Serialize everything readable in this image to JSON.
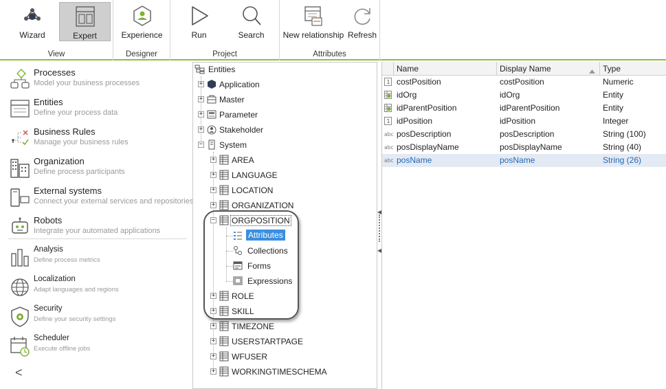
{
  "ribbon": {
    "groups": [
      {
        "label": "View"
      },
      {
        "label": "Designer"
      },
      {
        "label": "Project"
      },
      {
        "label": "Attributes"
      }
    ],
    "buttons": {
      "wizard": "Wizard",
      "expert": "Expert",
      "experience": "Experience",
      "run": "Run",
      "search": "Search",
      "new_relationship": "New relationship",
      "refresh": "Refresh"
    },
    "accent_color": "#8cbf3f"
  },
  "sidebar": {
    "items": [
      {
        "title": "Processes",
        "desc": "Model your business processes",
        "icon": "processes-icon"
      },
      {
        "title": "Entities",
        "desc": "Define your process data",
        "icon": "entities-icon"
      },
      {
        "title": "Business Rules",
        "desc": "Manage your business rules",
        "icon": "business-rules-icon"
      },
      {
        "title": "Organization",
        "desc": "Define process participants",
        "icon": "organization-icon"
      },
      {
        "title": "External systems",
        "desc": "Connect your external services and repositories",
        "icon": "external-systems-icon"
      },
      {
        "title": "Robots",
        "desc": "Integrate your automated applications",
        "icon": "robots-icon"
      },
      {
        "title": "Analysis",
        "desc": "Define process metrics",
        "icon": "analysis-icon"
      },
      {
        "title": "Localization",
        "desc": "Adapt languages and regions",
        "icon": "localization-icon"
      },
      {
        "title": "Security",
        "desc": "Define your security settings",
        "icon": "security-icon"
      },
      {
        "title": "Scheduler",
        "desc": "Execute offline jobs",
        "icon": "scheduler-icon"
      }
    ],
    "collapse_glyph": "<"
  },
  "tree": {
    "root": "Entities",
    "top": [
      "Application",
      "Master",
      "Parameter",
      "Stakeholder",
      "System"
    ],
    "system_children": [
      "AREA",
      "LANGUAGE",
      "LOCATION",
      "ORGANIZATION",
      "ORGPOSITION"
    ],
    "orgposition_children": [
      "Attributes",
      "Collections",
      "Forms",
      "Expressions"
    ],
    "after": [
      "ROLE",
      "SKILL",
      "TIMEZONE",
      "USERSTARTPAGE",
      "WFUSER",
      "WORKINGTIMESCHEMA"
    ]
  },
  "grid": {
    "columns": [
      "Name",
      "Display Name",
      "Type"
    ],
    "rows": [
      {
        "name": "costPosition",
        "display": "costPosition",
        "type": "Numeric",
        "icon": "numeric-icon"
      },
      {
        "name": "idOrg",
        "display": "idOrg",
        "type": "Entity",
        "icon": "entity-icon"
      },
      {
        "name": "idParentPosition",
        "display": "idParentPosition",
        "type": "Entity",
        "icon": "entity-icon"
      },
      {
        "name": "idPosition",
        "display": "idPosition",
        "type": "Integer",
        "icon": "numeric-icon"
      },
      {
        "name": "posDescription",
        "display": "posDescription",
        "type": "String (100)",
        "icon": "string-icon"
      },
      {
        "name": "posDisplayName",
        "display": "posDisplayName",
        "type": "String (40)",
        "icon": "string-icon"
      },
      {
        "name": "posName",
        "display": "posName",
        "type": "String (26)",
        "icon": "string-icon"
      }
    ]
  }
}
